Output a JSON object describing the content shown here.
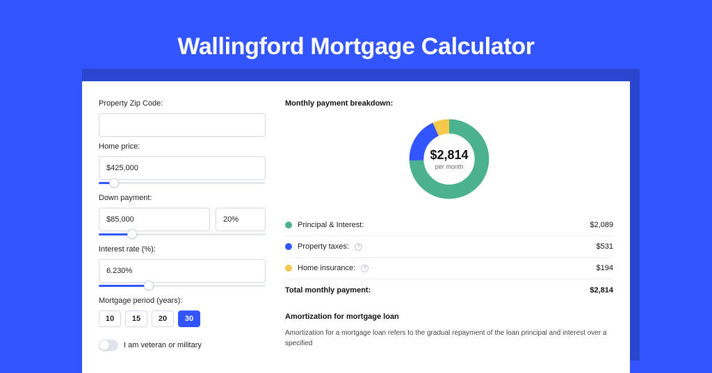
{
  "heading": "Wallingford Mortgage Calculator",
  "colors": {
    "brand": "#3355ff",
    "green": "#4bb18f",
    "blue": "#3355ff",
    "yellow": "#f2c94c"
  },
  "form": {
    "zip": {
      "label": "Property Zip Code:",
      "value": ""
    },
    "price": {
      "label": "Home price:",
      "value": "$425,000",
      "slider_pct": 9
    },
    "down": {
      "label": "Down payment:",
      "value": "$85,000",
      "pct": "20%",
      "slider_pct": 20
    },
    "rate": {
      "label": "Interest rate (%):",
      "value": "6.230%",
      "slider_pct": 30
    },
    "period": {
      "label": "Mortgage period (years):",
      "options": [
        "10",
        "15",
        "20",
        "30"
      ],
      "selected": "30"
    },
    "veteran": {
      "label": "I am veteran or military",
      "on": false
    }
  },
  "breakdown": {
    "title": "Monthly payment breakdown:",
    "center_value": "$2,814",
    "center_sub": "per month",
    "items": [
      {
        "name": "Principal & Interest:",
        "value": "$2,089",
        "info": false,
        "color": "#4bb18f"
      },
      {
        "name": "Property taxes:",
        "value": "$531",
        "info": true,
        "color": "#3355ff"
      },
      {
        "name": "Home insurance:",
        "value": "$194",
        "info": true,
        "color": "#f2c94c"
      }
    ],
    "total_label": "Total monthly payment:",
    "total_value": "$2,814"
  },
  "amort": {
    "title": "Amortization for mortgage loan",
    "text": "Amortization for a mortgage loan refers to the gradual repayment of the loan principal and interest over a specified"
  },
  "chart_data": {
    "type": "pie",
    "title": "Monthly payment breakdown",
    "series": [
      {
        "name": "Principal & Interest",
        "value": 2089,
        "color": "#4bb18f"
      },
      {
        "name": "Property taxes",
        "value": 531,
        "color": "#3355ff"
      },
      {
        "name": "Home insurance",
        "value": 194,
        "color": "#f2c94c"
      }
    ],
    "total": 2814,
    "center_label": "$2,814 per month"
  }
}
